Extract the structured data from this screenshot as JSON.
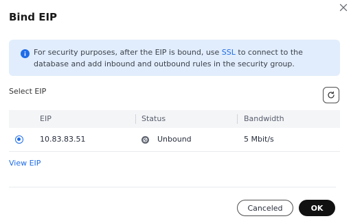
{
  "dialog": {
    "title": "Bind EIP",
    "close_icon": "close-icon"
  },
  "notice": {
    "icon": "info-icon",
    "text_before": "For security purposes, after the EIP is bound, use ",
    "link_text": "SSL",
    "text_after": " to connect to the database and add inbound and outbound rules in the security group."
  },
  "select": {
    "label": "Select EIP",
    "refresh_icon": "refresh-icon"
  },
  "table": {
    "columns": [
      "EIP",
      "Status",
      "Bandwidth"
    ],
    "rows": [
      {
        "selected": true,
        "eip": "10.83.83.51",
        "status": "Unbound",
        "bandwidth": "5 Mbit/s"
      }
    ]
  },
  "view_link": "View EIP",
  "footer": {
    "cancel_label": "Canceled",
    "ok_label": "OK"
  },
  "colors": {
    "accent": "#1e6ce8",
    "notice_bg": "#e1edfc",
    "primary_button": "#111111"
  }
}
